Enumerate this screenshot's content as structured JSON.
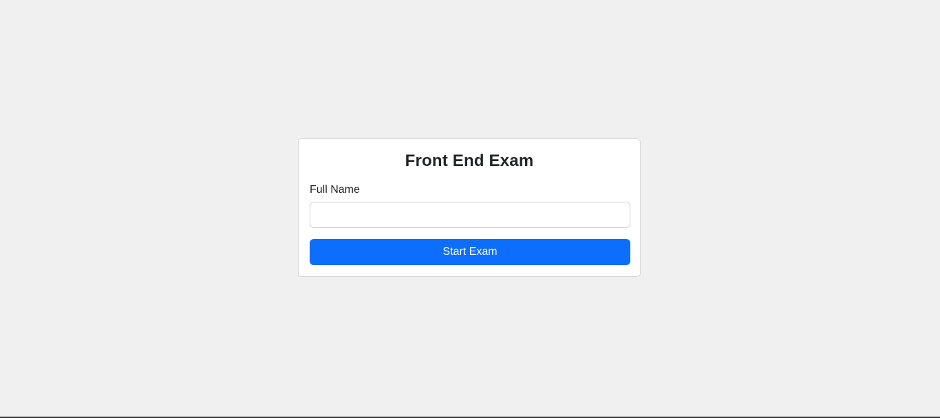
{
  "exam": {
    "title": "Front End Exam",
    "name_label": "Full Name",
    "name_value": "",
    "name_placeholder": "",
    "start_button_label": "Start Exam"
  },
  "colors": {
    "background": "#f0f0f0",
    "card": "#ffffff",
    "primary_button": "#0d6efd",
    "button_text": "#ffffff"
  }
}
